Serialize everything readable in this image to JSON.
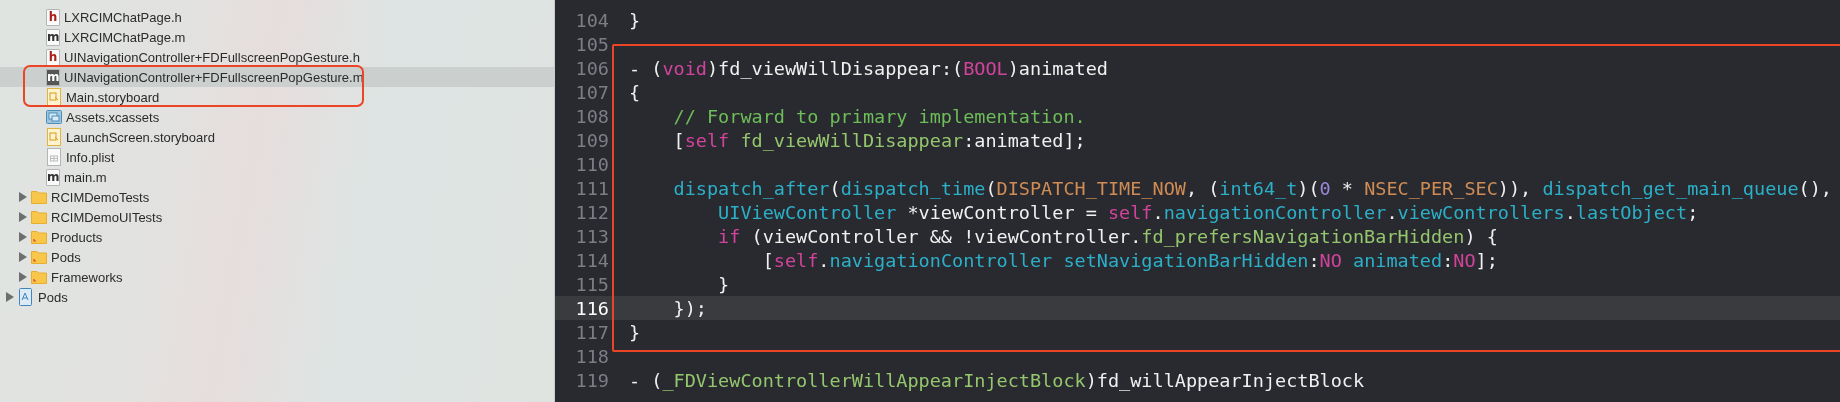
{
  "navigator": {
    "files": [
      {
        "name": "LXRCIMChatPage.h",
        "kind": "code",
        "badge": "h",
        "selected": false
      },
      {
        "name": "LXRCIMChatPage.m",
        "kind": "code",
        "badge": "m",
        "selected": false
      },
      {
        "name": "UINavigationController+FDFullscreenPopGesture.h",
        "kind": "code",
        "badge": "h",
        "selected": false
      },
      {
        "name": "UINavigationController+FDFullscreenPopGesture.m",
        "kind": "code",
        "badge": "m",
        "selected": true
      },
      {
        "name": "Main.storyboard",
        "kind": "storyboard",
        "selected": false
      },
      {
        "name": "Assets.xcassets",
        "kind": "assets",
        "selected": false
      },
      {
        "name": "LaunchScreen.storyboard",
        "kind": "storyboard",
        "selected": false
      },
      {
        "name": "Info.plist",
        "kind": "plist",
        "selected": false
      },
      {
        "name": "main.m",
        "kind": "code",
        "badge": "m",
        "selected": false
      }
    ],
    "folders": [
      {
        "name": "RCIMDemoTests",
        "kind": "group",
        "expanded": false
      },
      {
        "name": "RCIMDemoUITests",
        "kind": "group",
        "expanded": false
      },
      {
        "name": "Products",
        "kind": "marked",
        "expanded": false
      },
      {
        "name": "Pods",
        "kind": "marked",
        "expanded": false
      },
      {
        "name": "Frameworks",
        "kind": "marked",
        "expanded": false
      }
    ],
    "projects": [
      {
        "name": "Pods",
        "expanded": false
      }
    ]
  },
  "editor": {
    "lines": [
      {
        "number": "104",
        "current": false,
        "tokens": [
          {
            "kind": "plain",
            "text": "}"
          }
        ]
      },
      {
        "number": "105",
        "current": false
      },
      {
        "number": "106",
        "current": false,
        "tokens": [
          {
            "kind": "plain",
            "text": "- ("
          },
          {
            "kind": "keyword",
            "text": "void"
          },
          {
            "kind": "plain",
            "text": ")fd_viewWillDisappear:("
          },
          {
            "kind": "keyword",
            "text": "BOOL"
          },
          {
            "kind": "plain",
            "text": ")animated"
          }
        ]
      },
      {
        "number": "107",
        "current": false,
        "tokens": [
          {
            "kind": "plain",
            "text": "{"
          }
        ]
      },
      {
        "number": "108",
        "current": false,
        "tokens": [
          {
            "kind": "comment",
            "text": "    // Forward to primary implementation."
          }
        ]
      },
      {
        "number": "109",
        "current": false,
        "tokens": [
          {
            "kind": "plain",
            "text": "    ["
          },
          {
            "kind": "keyword",
            "text": "self"
          },
          {
            "kind": "method",
            "text": " fd_viewWillDisappear"
          },
          {
            "kind": "plain",
            "text": ":animated];"
          }
        ]
      },
      {
        "number": "110",
        "current": false
      },
      {
        "number": "111",
        "current": false,
        "tokens": [
          {
            "kind": "type",
            "text": "    dispatch_after"
          },
          {
            "kind": "plain",
            "text": "("
          },
          {
            "kind": "type",
            "text": "dispatch_time"
          },
          {
            "kind": "plain",
            "text": "("
          },
          {
            "kind": "macro",
            "text": "DISPATCH_TIME_NOW"
          },
          {
            "kind": "plain",
            "text": ", ("
          },
          {
            "kind": "type",
            "text": "int64_t"
          },
          {
            "kind": "plain",
            "text": ")("
          },
          {
            "kind": "number",
            "text": "0"
          },
          {
            "kind": "plain",
            "text": " * "
          },
          {
            "kind": "macro",
            "text": "NSEC_PER_SEC"
          },
          {
            "kind": "plain",
            "text": ")), "
          },
          {
            "kind": "type",
            "text": "dispatch_get_main_queue"
          },
          {
            "kind": "plain",
            "text": "(),"
          }
        ]
      },
      {
        "number": "112",
        "current": false,
        "tokens": [
          {
            "kind": "type",
            "text": "        UIViewController"
          },
          {
            "kind": "plain",
            "text": " *viewController = "
          },
          {
            "kind": "keyword",
            "text": "self"
          },
          {
            "kind": "plain",
            "text": "."
          },
          {
            "kind": "type",
            "text": "navigationController"
          },
          {
            "kind": "plain",
            "text": "."
          },
          {
            "kind": "type",
            "text": "viewControllers"
          },
          {
            "kind": "plain",
            "text": "."
          },
          {
            "kind": "type",
            "text": "lastObject"
          },
          {
            "kind": "plain",
            "text": ";"
          }
        ]
      },
      {
        "number": "113",
        "current": false,
        "tokens": [
          {
            "kind": "keyword",
            "text": "        if"
          },
          {
            "kind": "plain",
            "text": " (viewController && !viewController."
          },
          {
            "kind": "method",
            "text": "fd_prefersNavigationBarHidden"
          },
          {
            "kind": "plain",
            "text": ") {"
          }
        ]
      },
      {
        "number": "114",
        "current": false,
        "tokens": [
          {
            "kind": "plain",
            "text": "            ["
          },
          {
            "kind": "keyword",
            "text": "self"
          },
          {
            "kind": "plain",
            "text": "."
          },
          {
            "kind": "type",
            "text": "navigationController"
          },
          {
            "kind": "type",
            "text": " setNavigationBarHidden"
          },
          {
            "kind": "plain",
            "text": ":"
          },
          {
            "kind": "keyword",
            "text": "NO"
          },
          {
            "kind": "type",
            "text": " animated"
          },
          {
            "kind": "plain",
            "text": ":"
          },
          {
            "kind": "keyword",
            "text": "NO"
          },
          {
            "kind": "plain",
            "text": "];"
          }
        ]
      },
      {
        "number": "115",
        "current": false,
        "tokens": [
          {
            "kind": "plain",
            "text": "        }"
          }
        ]
      },
      {
        "number": "116",
        "current": true,
        "tokens": [
          {
            "kind": "plain",
            "text": "    });"
          }
        ]
      },
      {
        "number": "117",
        "current": false,
        "tokens": [
          {
            "kind": "plain",
            "text": "}"
          }
        ]
      },
      {
        "number": "118",
        "current": false
      },
      {
        "number": "119",
        "current": false,
        "tokens": [
          {
            "kind": "plain",
            "text": "- ("
          },
          {
            "kind": "method",
            "text": "_FDViewControllerWillAppearInjectBlock"
          },
          {
            "kind": "plain",
            "text": ")fd_willAppearInjectBlock"
          }
        ]
      }
    ]
  }
}
